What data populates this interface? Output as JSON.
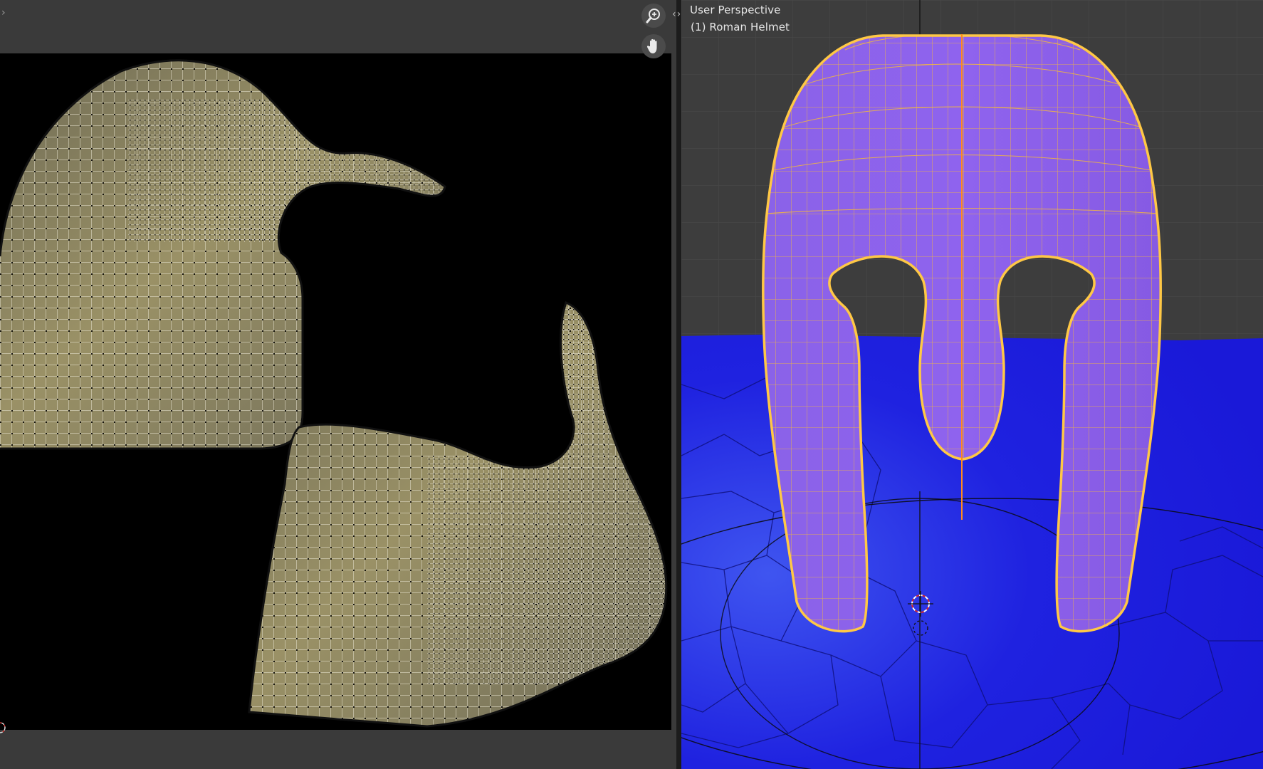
{
  "uv_editor": {
    "toolbar_toggle": "›",
    "zoom_button": "zoom-in",
    "pan_button": "hand-pan"
  },
  "viewport": {
    "view_name": "User Perspective",
    "object_label": "(1) Roman Helmet"
  },
  "split_arrows": "‹›",
  "colors": {
    "mesh_face": "#8f62ec",
    "wireframe": "#ffc845",
    "floor": "#1a1ae6",
    "uv_fill": "#8b8561",
    "uv_background": "#000000"
  }
}
